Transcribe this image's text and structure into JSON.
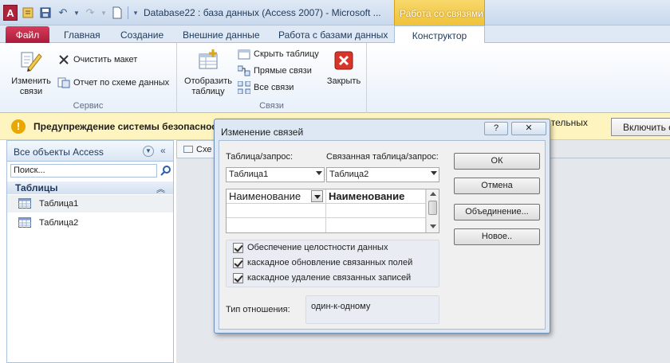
{
  "titlebar": {
    "app_icon": "A",
    "title": "Database22 : база данных (Access 2007)  -  Microsoft ...",
    "context_group": "Работа со связями"
  },
  "tabs": {
    "file": "Файл",
    "home": "Главная",
    "create": "Создание",
    "external": "Внешние данные",
    "dbtools": "Работа с базами данных",
    "designer": "Конструктор"
  },
  "ribbon": {
    "service": {
      "label": "Сервис",
      "edit_relationships": "Изменить связи",
      "clear_layout": "Очистить макет",
      "report": "Отчет по схеме данных"
    },
    "relationships": {
      "label": "Связи",
      "show_table": "Отобразить таблицу",
      "hide_table": "Скрыть таблицу",
      "direct": "Прямые связи",
      "all": "Все связи",
      "close": "Закрыть"
    }
  },
  "warning": {
    "text": "Предупреждение системы безопасности",
    "tail": "ительных",
    "enable": "Включить с"
  },
  "nav": {
    "title": "Все объекты Access",
    "search_placeholder": "Поиск...",
    "group": "Таблицы",
    "items": [
      "Таблица1",
      "Таблица2"
    ]
  },
  "workspace": {
    "tab_label": "Схе"
  },
  "dialog": {
    "title": "Изменение связей",
    "help": "?",
    "close": "✕",
    "table_label": "Таблица/запрос:",
    "related_label": "Связанная таблица/запрос:",
    "table_value": "Таблица1",
    "related_value": "Таблица2",
    "field_left": "Наименование",
    "field_right": "Наименование",
    "checkboxes": {
      "integrity": "Обеспечение целостности данных",
      "cascade_update": "каскадное обновление связанных полей",
      "cascade_delete": "каскадное удаление связанных записей"
    },
    "reltype_label": "Тип отношения:",
    "reltype_value": "один-к-одному",
    "buttons": {
      "ok": "ОК",
      "cancel": "Отмена",
      "join": "Объединение...",
      "new": "Новое.."
    }
  }
}
